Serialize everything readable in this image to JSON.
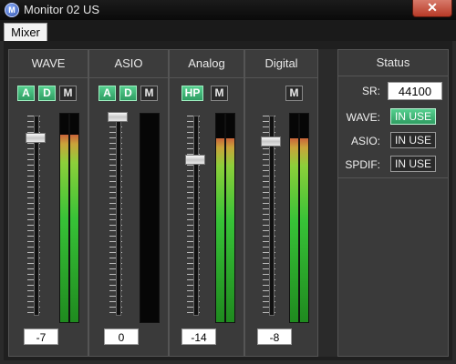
{
  "window": {
    "title": "Monitor 02 US",
    "close_glyph": "✕",
    "app_icon_letter": "M"
  },
  "tabs": [
    {
      "label": "Mixer",
      "selected": true
    }
  ],
  "channels": [
    {
      "name": "WAVE",
      "buttons": [
        {
          "label": "A",
          "active": true
        },
        {
          "label": "D",
          "active": true
        },
        {
          "label": "M",
          "active": false
        }
      ],
      "value": "-7",
      "meter_level": 0.9
    },
    {
      "name": "ASIO",
      "buttons": [
        {
          "label": "A",
          "active": true
        },
        {
          "label": "D",
          "active": true
        },
        {
          "label": "M",
          "active": false
        }
      ],
      "value": "0",
      "meter_level": 0.0
    },
    {
      "name": "Analog",
      "buttons": [
        {
          "label": "HP",
          "active": true
        },
        {
          "label": "M",
          "active": false
        }
      ],
      "value": "-14",
      "meter_level": 0.88
    },
    {
      "name": "Digital",
      "buttons": [
        {
          "label": "M",
          "active": false
        }
      ],
      "value": "-8",
      "meter_level": 0.88
    }
  ],
  "status": {
    "title": "Status",
    "sr_label": "SR:",
    "sr_value": "44100",
    "rows": [
      {
        "label": "WAVE:",
        "value": "IN USE",
        "active": true
      },
      {
        "label": "ASIO:",
        "value": "IN USE",
        "active": false
      },
      {
        "label": "SPDIF:",
        "value": "IN USE",
        "active": false
      }
    ]
  },
  "colors": {
    "active_green": "#3fb878",
    "meter_green": "#37c237",
    "panel": "#3a3a3a"
  }
}
